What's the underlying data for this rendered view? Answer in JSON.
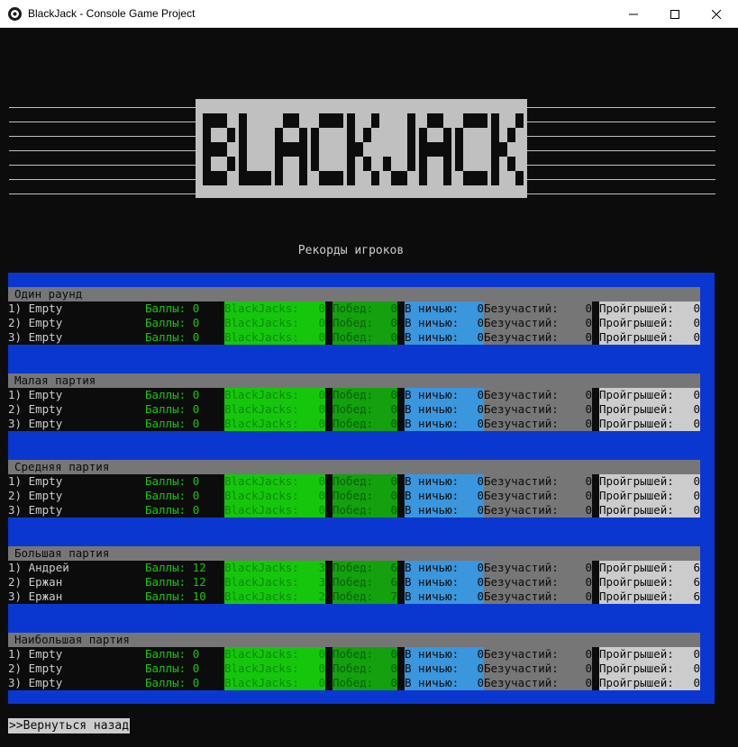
{
  "window": {
    "title": "BlackJack - Console Game Project",
    "icon": "app-icon",
    "controls": [
      "minimize-icon",
      "maximize-icon",
      "close-icon"
    ]
  },
  "logo_text": "BLACKJACK",
  "records_title": "Рекорды игроков",
  "labels": {
    "score": "Баллы:",
    "blackjacks": "BlackJacks:",
    "wins": "Побед:",
    "draws": "В ничью:",
    "apathy": "Безучастий:",
    "losses": "Пройгрышей:"
  },
  "sections": [
    {
      "title": "Один раунд",
      "rows": [
        {
          "rank": "1)",
          "name": "Empty",
          "score": "0",
          "blackjacks": "0",
          "wins": "0",
          "draws": "0",
          "apathy": "0",
          "losses": "0"
        },
        {
          "rank": "2)",
          "name": "Empty",
          "score": "0",
          "blackjacks": "0",
          "wins": "0",
          "draws": "0",
          "apathy": "0",
          "losses": "0"
        },
        {
          "rank": "3)",
          "name": "Empty",
          "score": "0",
          "blackjacks": "0",
          "wins": "0",
          "draws": "0",
          "apathy": "0",
          "losses": "0"
        }
      ]
    },
    {
      "title": "Малая партия",
      "rows": [
        {
          "rank": "1)",
          "name": "Empty",
          "score": "0",
          "blackjacks": "0",
          "wins": "0",
          "draws": "0",
          "apathy": "0",
          "losses": "0"
        },
        {
          "rank": "2)",
          "name": "Empty",
          "score": "0",
          "blackjacks": "0",
          "wins": "0",
          "draws": "0",
          "apathy": "0",
          "losses": "0"
        },
        {
          "rank": "3)",
          "name": "Empty",
          "score": "0",
          "blackjacks": "0",
          "wins": "0",
          "draws": "0",
          "apathy": "0",
          "losses": "0"
        }
      ]
    },
    {
      "title": "Средняя партия",
      "rows": [
        {
          "rank": "1)",
          "name": "Empty",
          "score": "0",
          "blackjacks": "0",
          "wins": "0",
          "draws": "0",
          "apathy": "0",
          "losses": "0"
        },
        {
          "rank": "2)",
          "name": "Empty",
          "score": "0",
          "blackjacks": "0",
          "wins": "0",
          "draws": "0",
          "apathy": "0",
          "losses": "0"
        },
        {
          "rank": "3)",
          "name": "Empty",
          "score": "0",
          "blackjacks": "0",
          "wins": "0",
          "draws": "0",
          "apathy": "0",
          "losses": "0"
        }
      ]
    },
    {
      "title": "Большая партия",
      "rows": [
        {
          "rank": "1)",
          "name": "Андрей",
          "score": "12",
          "blackjacks": "3",
          "wins": "6",
          "draws": "0",
          "apathy": "0",
          "losses": "6"
        },
        {
          "rank": "2)",
          "name": "Ержан",
          "score": "12",
          "blackjacks": "3",
          "wins": "6",
          "draws": "0",
          "apathy": "0",
          "losses": "6"
        },
        {
          "rank": "3)",
          "name": "Ержан",
          "score": "10",
          "blackjacks": "2",
          "wins": "7",
          "draws": "0",
          "apathy": "0",
          "losses": "6"
        }
      ]
    },
    {
      "title": "Наибольшая партия",
      "rows": [
        {
          "rank": "1)",
          "name": "Empty",
          "score": "0",
          "blackjacks": "0",
          "wins": "0",
          "draws": "0",
          "apathy": "0",
          "losses": "0"
        },
        {
          "rank": "2)",
          "name": "Empty",
          "score": "0",
          "blackjacks": "0",
          "wins": "0",
          "draws": "0",
          "apathy": "0",
          "losses": "0"
        },
        {
          "rank": "3)",
          "name": "Empty",
          "score": "0",
          "blackjacks": "0",
          "wins": "0",
          "draws": "0",
          "apathy": "0",
          "losses": "0"
        }
      ]
    }
  ],
  "back_label": ">>Вернуться назад",
  "colors": {
    "console_bg": "#0c0c0c",
    "panel_blue": "#0b37d1",
    "header_gray": "#767676",
    "green_bright": "#16c60c",
    "green_dark": "#13a10e",
    "cyan_blue": "#3a96dd",
    "light_gray": "#cccccc"
  }
}
